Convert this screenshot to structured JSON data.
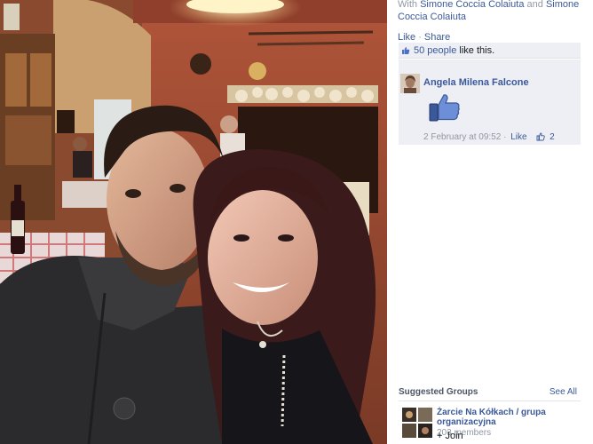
{
  "side": {
    "with_prefix": "With",
    "tagged": [
      "Simone Coccia Colaiuta",
      "Simone Coccia Colaiuta"
    ],
    "and_word": "and",
    "actions": {
      "like": "Like",
      "share": "Share",
      "separator": "·"
    }
  },
  "ufi": {
    "likes_count": "50 people",
    "likes_suffix": "like this.",
    "comment": {
      "author": "Angela Milena Falcone",
      "sticker": "thumbs-up-sticker",
      "timestamp": "2 February at 09:52",
      "separator": "·",
      "like_label": "Like",
      "like_count": "2"
    }
  },
  "suggested": {
    "title": "Suggested Groups",
    "see_all": "See All",
    "group": {
      "name": "Żarcie Na Kółkach / grupa organizacyjna",
      "members": "203 members",
      "join_label": "+ Join"
    }
  },
  "colors": {
    "link": "#3b5998",
    "muted": "#9197a3",
    "panel_bg": "#edeff4",
    "thumb_blue": "#4a70c8"
  },
  "icons": [
    "thumbs-up-icon",
    "thumbs-up-sticker",
    "group-photo-thumbnail"
  ]
}
